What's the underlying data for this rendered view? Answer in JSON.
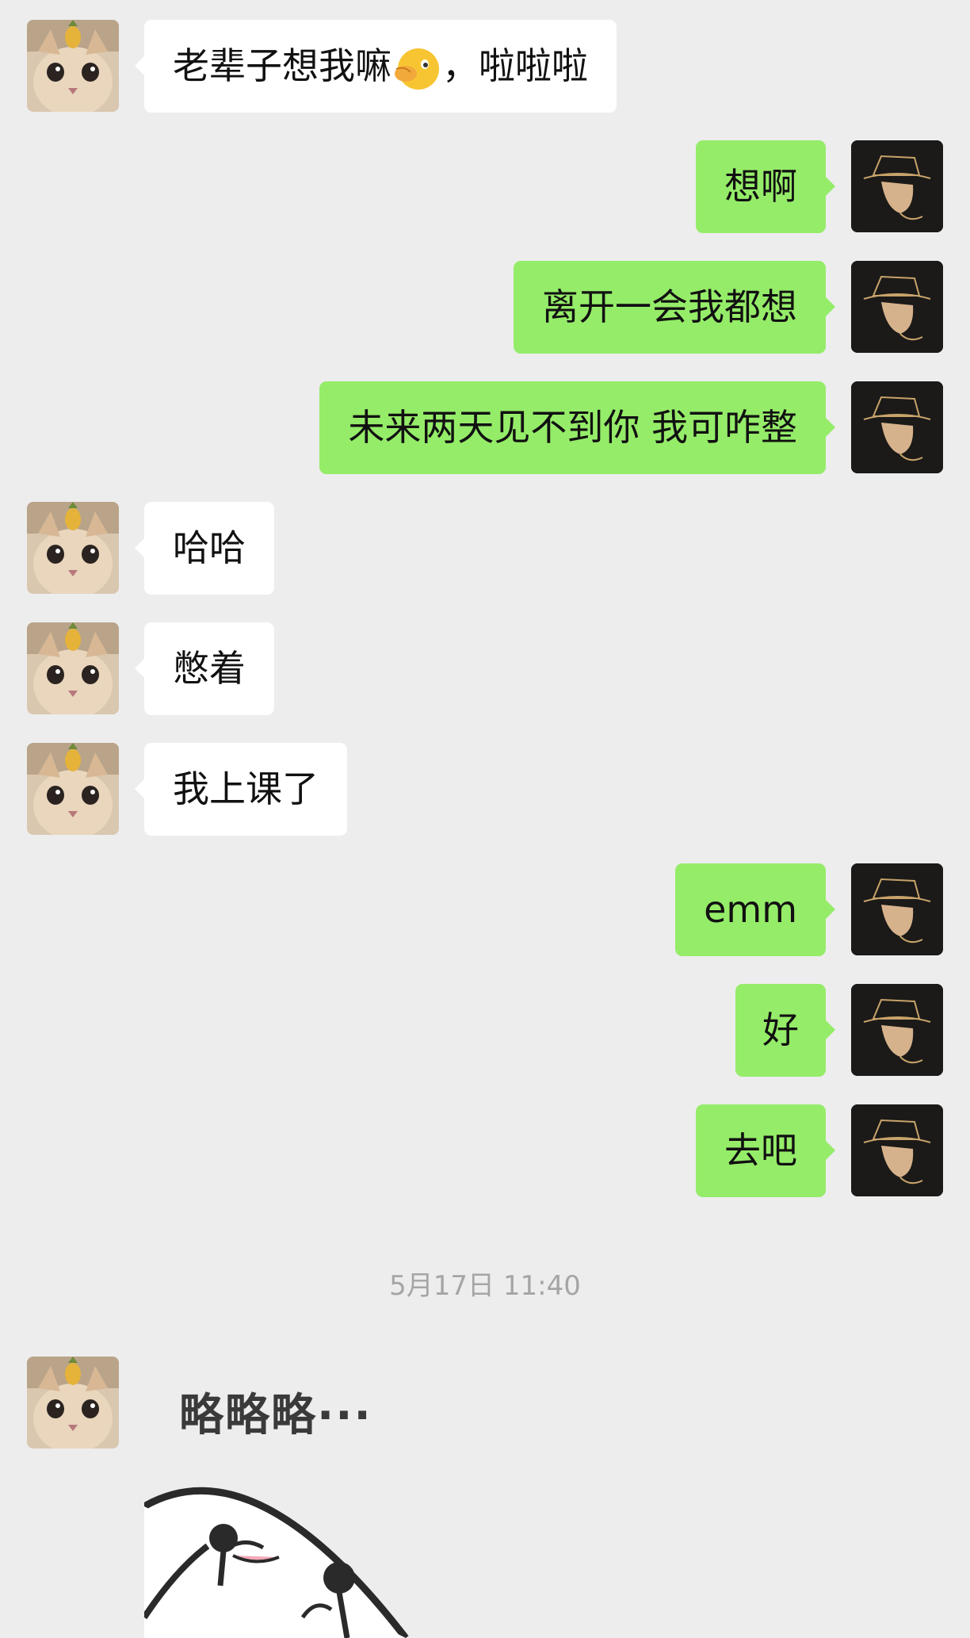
{
  "messages": [
    {
      "side": "in",
      "text": "老辈子想我嘛",
      "suffix": "，啦啦啦",
      "emoji": "hand-over-mouth-emoji"
    },
    {
      "side": "out",
      "text": "想啊"
    },
    {
      "side": "out",
      "text": "离开一会我都想"
    },
    {
      "side": "out",
      "text": "未来两天见不到你 我可咋整"
    },
    {
      "side": "in",
      "text": "哈哈"
    },
    {
      "side": "in",
      "text": "憋着"
    },
    {
      "side": "in",
      "text": "我上课了"
    },
    {
      "side": "out",
      "text": "emm"
    },
    {
      "side": "out",
      "text": "好"
    },
    {
      "side": "out",
      "text": "去吧"
    }
  ],
  "timestamp": "5月17日 11:40",
  "sticker": {
    "text": "略略略···",
    "icon": "laughing-face-sticker"
  },
  "avatars": {
    "contact": "cat-pineapple-avatar",
    "self": "top-hat-man-avatar"
  },
  "colors": {
    "background": "#ededed",
    "incoming_bubble": "#ffffff",
    "outgoing_bubble": "#95ec69",
    "timestamp": "#a5a5a5"
  }
}
